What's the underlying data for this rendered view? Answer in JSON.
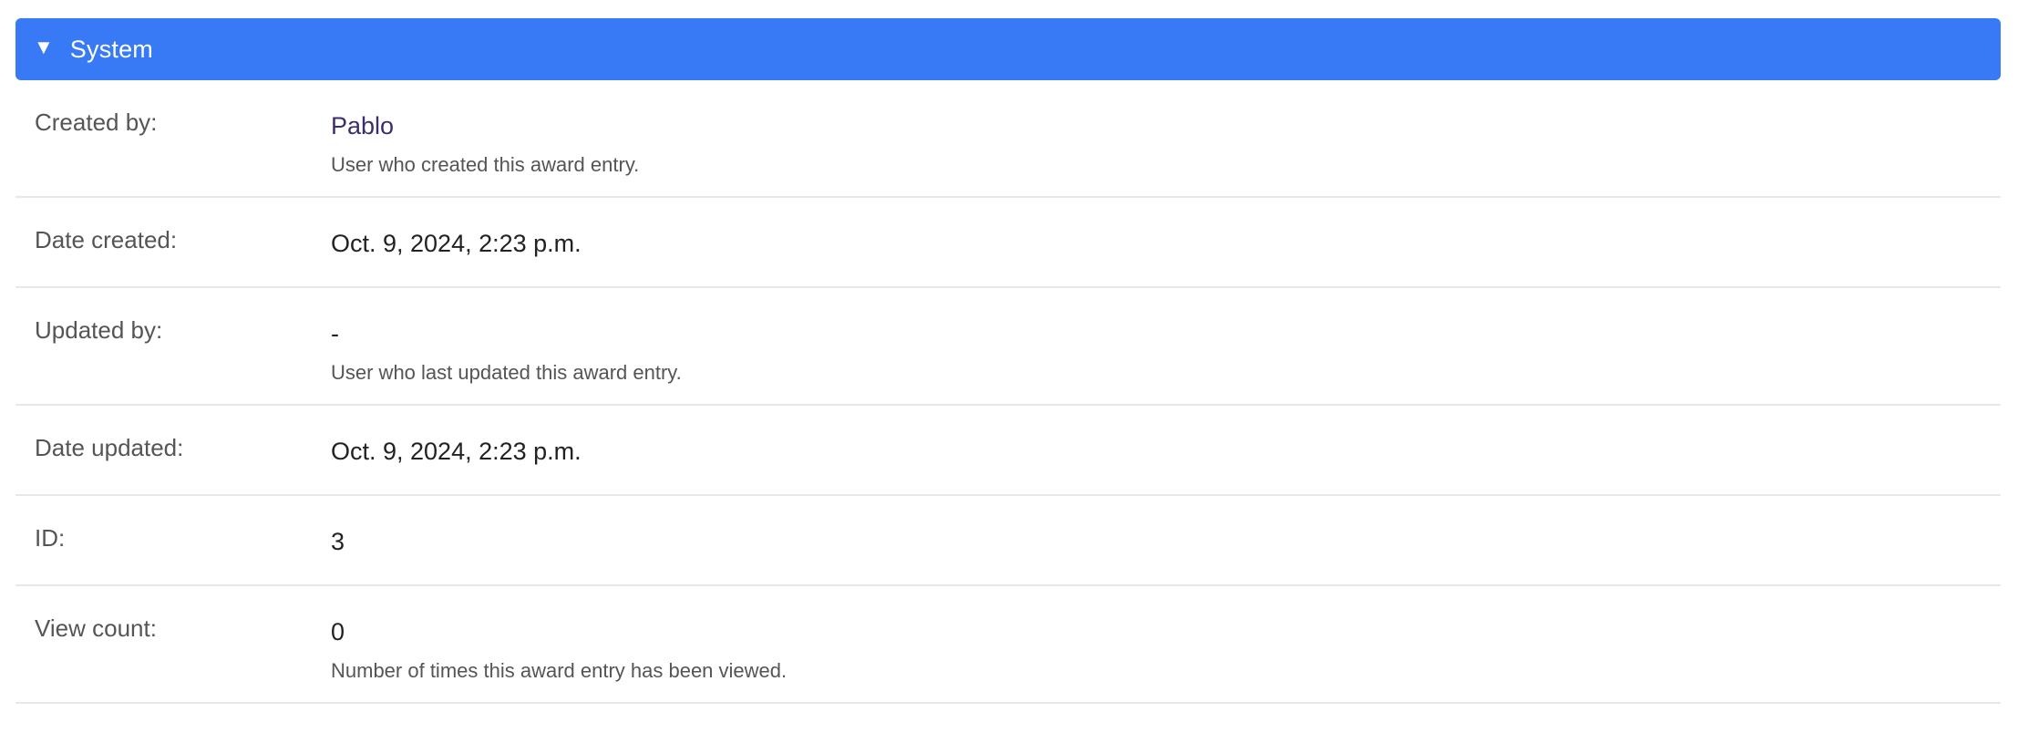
{
  "section": {
    "title": "System",
    "caret": "▼"
  },
  "fields": {
    "created_by": {
      "label": "Created by:",
      "value": "Pablo",
      "help": "User who created this award entry."
    },
    "date_created": {
      "label": "Date created:",
      "value": "Oct. 9, 2024, 2:23 p.m."
    },
    "updated_by": {
      "label": "Updated by:",
      "value": "-",
      "help": "User who last updated this award entry."
    },
    "date_updated": {
      "label": "Date updated:",
      "value": "Oct. 9, 2024, 2:23 p.m."
    },
    "id": {
      "label": "ID:",
      "value": "3"
    },
    "view_count": {
      "label": "View count:",
      "value": "0",
      "help": "Number of times this award entry has been viewed."
    }
  },
  "colors": {
    "header_bg": "#387af6",
    "header_text": "#ffffff",
    "link": "#3e2d6b",
    "divider": "#e8e8e8"
  }
}
